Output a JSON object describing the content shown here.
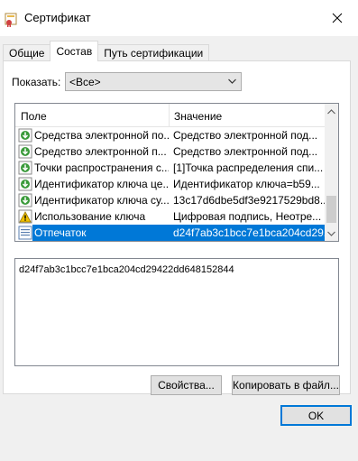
{
  "window": {
    "title": "Сертификат",
    "close_icon": "close-icon"
  },
  "tabs": [
    {
      "label": "Общие",
      "active": false
    },
    {
      "label": "Состав",
      "active": true
    },
    {
      "label": "Путь сертификации",
      "active": false
    }
  ],
  "show": {
    "label": "Показать:",
    "value": "<Все>"
  },
  "list": {
    "columns": {
      "field": "Поле",
      "value": "Значение"
    },
    "rows": [
      {
        "icon": "green-download-icon",
        "field": "Средства электронной по...",
        "value": "Средство электронной под..."
      },
      {
        "icon": "green-download-icon",
        "field": "Средство электронной п...",
        "value": "Средство электронной под..."
      },
      {
        "icon": "green-download-icon",
        "field": "Точки распространения с...",
        "value": "[1]Точка распределения спи..."
      },
      {
        "icon": "green-download-icon",
        "field": "Идентификатор ключа це...",
        "value": "Идентификатор ключа=b59..."
      },
      {
        "icon": "green-download-icon",
        "field": "Идентификатор ключа су...",
        "value": "13c17d6dbe5df3e9217529bd8..."
      },
      {
        "icon": "warning-icon",
        "field": "Использование ключа",
        "value": "Цифровая подпись, Неотре..."
      },
      {
        "icon": "properties-icon",
        "field": "Отпечаток",
        "value": "d24f7ab3c1bcc7e1bca204cd29...",
        "selected": true
      }
    ]
  },
  "detail": {
    "text": "d24f7ab3c1bcc7e1bca204cd29422dd648152844"
  },
  "buttons": {
    "properties": "Свойства...",
    "copy": "Копировать в файл...",
    "ok": "OK"
  },
  "colors": {
    "selection": "#0078d7",
    "ok_border": "#0078d7"
  }
}
